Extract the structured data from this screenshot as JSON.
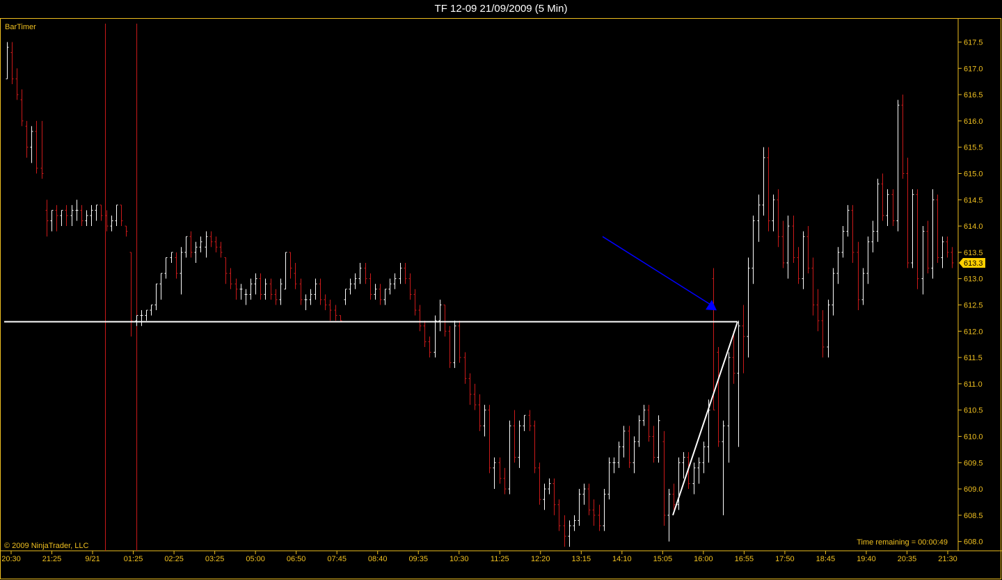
{
  "window": {
    "title": "TF 12-09  21/09/2009 (5 Min)"
  },
  "indicator_label": "BarTimer",
  "copyright": "© 2009 NinjaTrader, LLC",
  "time_remaining": "Time remaining = 00:00:49",
  "last_price_label": "613.3",
  "colors": {
    "background": "#000000",
    "border": "#f0c020",
    "text": "#f0c020",
    "up_bar": "#ffffff",
    "down_bar": "#cc1a1a",
    "session_line": "#cc1a1a",
    "hline": "#ffffff",
    "arrow": "#0000ff",
    "price_marker": "#ffd000"
  },
  "chart_data": {
    "type": "ohlc",
    "title": "TF 12-09  21/09/2009 (5 Min)",
    "ylim": [
      607.85,
      617.85
    ],
    "yticks": [
      "608.0",
      "608.5",
      "609.0",
      "609.5",
      "610.0",
      "610.5",
      "611.0",
      "611.5",
      "612.0",
      "612.5",
      "613.0",
      "613.5",
      "614.0",
      "614.5",
      "615.0",
      "615.5",
      "616.0",
      "616.5",
      "617.0",
      "617.5"
    ],
    "xticks": [
      "20:30",
      "21:25",
      "9/21",
      "01:25",
      "02:25",
      "03:25",
      "05:00",
      "06:50",
      "07:45",
      "08:40",
      "09:35",
      "10:30",
      "11:25",
      "12:20",
      "13:15",
      "14:10",
      "15:05",
      "16:00",
      "16:55",
      "17:50",
      "18:45",
      "19:40",
      "20:35",
      "21:30"
    ],
    "last_price": 613.3,
    "horizontal_line": 612.18,
    "session_breaks": [
      "21:25-9/21",
      "9/21"
    ],
    "bars": [
      [
        616.8,
        617.5,
        616.8,
        617.4
      ],
      [
        617.3,
        617.5,
        616.7,
        616.8
      ],
      [
        616.8,
        617.0,
        616.4,
        616.5
      ],
      [
        616.4,
        616.6,
        615.9,
        616.0
      ],
      [
        615.9,
        616.0,
        615.3,
        615.5
      ],
      [
        615.5,
        615.9,
        615.2,
        615.8
      ],
      [
        615.8,
        616.0,
        615.0,
        615.1
      ],
      [
        615.1,
        616.0,
        614.9,
        615.0
      ],
      [
        614.3,
        614.5,
        613.8,
        614.1
      ],
      [
        614.1,
        614.3,
        613.9,
        614.3
      ],
      [
        614.3,
        614.4,
        613.9,
        614.2
      ],
      [
        614.2,
        614.3,
        614.0,
        614.3
      ],
      [
        614.3,
        614.4,
        614.0,
        614.2
      ],
      [
        614.2,
        614.4,
        614.0,
        614.3
      ],
      [
        614.3,
        614.5,
        614.1,
        614.3
      ],
      [
        614.3,
        614.4,
        614.0,
        614.1
      ],
      [
        614.1,
        614.3,
        614.0,
        614.2
      ],
      [
        614.2,
        614.4,
        614.0,
        614.3
      ],
      [
        614.3,
        614.4,
        614.1,
        614.4
      ],
      [
        614.4,
        614.4,
        614.1,
        614.2
      ],
      [
        614.2,
        614.3,
        613.9,
        614.0
      ],
      [
        614.0,
        614.2,
        613.9,
        614.1
      ],
      [
        614.1,
        614.4,
        614.0,
        614.4
      ],
      [
        614.4,
        614.4,
        614.0,
        614.1
      ],
      [
        614.0,
        614.0,
        613.8,
        613.9
      ],
      [
        613.5,
        613.5,
        611.9,
        612.2
      ],
      [
        612.2,
        612.3,
        612.1,
        612.3
      ],
      [
        612.3,
        612.4,
        612.1,
        612.3
      ],
      [
        612.3,
        612.4,
        612.2,
        612.4
      ],
      [
        612.4,
        612.5,
        612.3,
        612.5
      ],
      [
        612.5,
        612.9,
        612.4,
        612.9
      ],
      [
        612.9,
        613.1,
        612.6,
        613.1
      ],
      [
        613.1,
        613.4,
        613.0,
        613.4
      ],
      [
        613.4,
        613.5,
        613.3,
        613.5
      ],
      [
        613.4,
        613.5,
        613.0,
        613.1
      ],
      [
        613.1,
        613.6,
        612.7,
        613.5
      ],
      [
        613.5,
        613.8,
        613.4,
        613.8
      ],
      [
        613.8,
        613.9,
        613.4,
        613.5
      ],
      [
        613.5,
        613.7,
        613.3,
        613.6
      ],
      [
        613.6,
        613.8,
        613.5,
        613.7
      ],
      [
        613.6,
        613.9,
        613.4,
        613.8
      ],
      [
        613.8,
        613.9,
        613.6,
        613.7
      ],
      [
        613.7,
        613.8,
        613.5,
        613.6
      ],
      [
        613.6,
        613.7,
        613.4,
        613.5
      ],
      [
        613.4,
        613.4,
        612.9,
        613.1
      ],
      [
        613.1,
        613.2,
        612.8,
        612.9
      ],
      [
        612.9,
        613.0,
        612.6,
        612.8
      ],
      [
        612.8,
        612.9,
        612.6,
        612.8
      ],
      [
        612.7,
        612.8,
        612.5,
        612.7
      ],
      [
        612.7,
        613.0,
        612.6,
        612.9
      ],
      [
        612.9,
        613.1,
        612.7,
        613.0
      ],
      [
        613.0,
        613.1,
        612.6,
        612.7
      ],
      [
        612.7,
        613.0,
        612.6,
        612.9
      ],
      [
        612.9,
        613.0,
        612.6,
        612.7
      ],
      [
        612.7,
        612.8,
        612.5,
        612.6
      ],
      [
        612.6,
        613.0,
        612.5,
        612.9
      ],
      [
        612.8,
        613.5,
        612.8,
        613.5
      ],
      [
        613.5,
        613.5,
        613.0,
        613.2
      ],
      [
        613.1,
        613.3,
        612.8,
        612.9
      ],
      [
        612.9,
        613.0,
        612.5,
        612.6
      ],
      [
        612.6,
        612.7,
        612.4,
        612.6
      ],
      [
        612.6,
        612.8,
        612.5,
        612.7
      ],
      [
        612.7,
        613.0,
        612.6,
        612.9
      ],
      [
        612.9,
        613.0,
        612.5,
        612.6
      ],
      [
        612.6,
        612.7,
        612.4,
        612.5
      ],
      [
        612.5,
        612.6,
        612.2,
        612.4
      ],
      [
        612.4,
        612.5,
        612.2,
        612.3
      ],
      [
        612.3,
        612.3,
        612.2,
        612.2
      ],
      [
        612.6,
        612.8,
        612.5,
        612.8
      ],
      [
        612.8,
        613.0,
        612.7,
        612.9
      ],
      [
        612.9,
        613.1,
        612.8,
        613.0
      ],
      [
        613.0,
        613.3,
        612.9,
        613.2
      ],
      [
        613.2,
        613.3,
        612.9,
        613.0
      ],
      [
        613.0,
        613.1,
        612.6,
        612.7
      ],
      [
        612.7,
        612.9,
        612.6,
        612.8
      ],
      [
        612.8,
        612.9,
        612.5,
        612.6
      ],
      [
        612.6,
        612.8,
        612.5,
        612.8
      ],
      [
        612.8,
        613.0,
        612.7,
        612.9
      ],
      [
        612.9,
        613.1,
        612.8,
        613.0
      ],
      [
        613.0,
        613.3,
        612.9,
        613.2
      ],
      [
        613.2,
        613.3,
        612.9,
        613.0
      ],
      [
        613.0,
        613.1,
        612.6,
        612.7
      ],
      [
        612.7,
        612.8,
        612.3,
        612.4
      ],
      [
        612.4,
        612.5,
        612.0,
        612.1
      ],
      [
        612.1,
        612.2,
        611.7,
        611.8
      ],
      [
        611.8,
        611.9,
        611.5,
        611.6
      ],
      [
        611.6,
        612.3,
        611.5,
        612.2
      ],
      [
        612.2,
        612.6,
        612.0,
        612.5
      ],
      [
        612.5,
        612.5,
        611.9,
        612.0
      ],
      [
        612.0,
        612.1,
        611.3,
        611.4
      ],
      [
        611.4,
        612.2,
        611.3,
        612.1
      ],
      [
        612.1,
        612.2,
        611.4,
        611.5
      ],
      [
        611.5,
        611.6,
        611.0,
        611.1
      ],
      [
        611.1,
        611.2,
        610.6,
        610.8
      ],
      [
        610.8,
        611.0,
        610.5,
        610.6
      ],
      [
        610.6,
        610.8,
        610.1,
        610.2
      ],
      [
        610.2,
        610.6,
        610.0,
        610.5
      ],
      [
        610.5,
        610.6,
        609.3,
        609.4
      ],
      [
        609.4,
        609.6,
        609.0,
        609.5
      ],
      [
        609.5,
        609.6,
        609.1,
        609.2
      ],
      [
        609.2,
        609.4,
        608.9,
        609.0
      ],
      [
        609.0,
        610.3,
        608.9,
        610.2
      ],
      [
        610.2,
        610.5,
        609.5,
        609.6
      ],
      [
        609.6,
        610.3,
        609.4,
        610.2
      ],
      [
        610.2,
        610.4,
        610.1,
        610.4
      ],
      [
        610.4,
        610.5,
        610.1,
        610.2
      ],
      [
        610.2,
        610.3,
        609.3,
        609.4
      ],
      [
        609.4,
        609.5,
        608.7,
        608.8
      ],
      [
        608.8,
        609.1,
        608.6,
        609.0
      ],
      [
        609.0,
        609.2,
        608.9,
        609.1
      ],
      [
        609.1,
        609.2,
        608.5,
        608.7
      ],
      [
        608.7,
        608.8,
        608.2,
        608.3
      ],
      [
        608.3,
        608.5,
        607.9,
        608.1
      ],
      [
        608.1,
        608.4,
        607.9,
        608.3
      ],
      [
        608.3,
        608.5,
        608.2,
        608.4
      ],
      [
        608.4,
        609.0,
        608.3,
        608.9
      ],
      [
        608.9,
        609.1,
        608.7,
        609.0
      ],
      [
        609.0,
        609.1,
        608.5,
        608.6
      ],
      [
        608.6,
        608.8,
        608.3,
        608.5
      ],
      [
        608.5,
        608.7,
        608.2,
        608.3
      ],
      [
        608.3,
        609.0,
        608.2,
        608.9
      ],
      [
        608.9,
        609.6,
        608.8,
        609.5
      ],
      [
        609.5,
        609.6,
        609.3,
        609.5
      ],
      [
        609.5,
        609.9,
        609.4,
        609.8
      ],
      [
        609.8,
        610.2,
        609.6,
        610.1
      ],
      [
        610.1,
        610.2,
        609.4,
        609.5
      ],
      [
        609.5,
        610.0,
        609.3,
        609.9
      ],
      [
        609.9,
        610.4,
        609.8,
        610.3
      ],
      [
        610.3,
        610.6,
        610.2,
        610.5
      ],
      [
        610.5,
        610.6,
        609.9,
        610.0
      ],
      [
        610.0,
        610.2,
        609.5,
        609.6
      ],
      [
        609.6,
        610.4,
        609.5,
        610.3
      ],
      [
        609.9,
        610.1,
        608.3,
        608.5
      ],
      [
        608.5,
        609.0,
        608.0,
        608.9
      ],
      [
        608.9,
        609.1,
        608.6,
        608.7
      ],
      [
        608.7,
        609.6,
        608.6,
        609.5
      ],
      [
        609.5,
        609.7,
        609.2,
        609.6
      ],
      [
        609.6,
        609.7,
        609.0,
        609.1
      ],
      [
        609.1,
        609.5,
        608.9,
        609.4
      ],
      [
        609.4,
        609.6,
        609.1,
        609.5
      ],
      [
        609.5,
        609.9,
        609.3,
        609.8
      ],
      [
        609.8,
        610.7,
        609.5,
        610.5
      ],
      [
        613.0,
        613.2,
        610.5,
        610.5
      ],
      [
        611.6,
        611.7,
        609.8,
        609.9
      ],
      [
        609.9,
        610.3,
        608.5,
        610.2
      ],
      [
        610.2,
        611.6,
        609.5,
        611.5
      ],
      [
        611.5,
        612.0,
        611.0,
        611.2
      ],
      [
        611.2,
        612.2,
        609.8,
        612.1
      ],
      [
        612.1,
        612.5,
        611.2,
        611.9
      ],
      [
        611.9,
        613.4,
        611.5,
        613.2
      ],
      [
        613.2,
        614.2,
        612.9,
        614.1
      ],
      [
        614.1,
        614.6,
        613.7,
        614.4
      ],
      [
        614.4,
        615.5,
        614.2,
        615.3
      ],
      [
        615.3,
        615.5,
        613.9,
        614.1
      ],
      [
        614.1,
        614.6,
        613.9,
        614.5
      ],
      [
        614.5,
        614.7,
        613.6,
        613.8
      ],
      [
        613.8,
        614.1,
        613.2,
        613.3
      ],
      [
        613.3,
        614.2,
        613.0,
        614.0
      ],
      [
        614.0,
        614.2,
        613.3,
        613.4
      ],
      [
        613.4,
        613.6,
        612.9,
        613.0
      ],
      [
        613.0,
        613.9,
        612.8,
        613.8
      ],
      [
        613.8,
        614.0,
        613.1,
        613.2
      ],
      [
        613.2,
        613.4,
        612.3,
        612.5
      ],
      [
        612.5,
        612.8,
        612.0,
        612.2
      ],
      [
        612.2,
        612.4,
        611.5,
        611.7
      ],
      [
        611.7,
        612.6,
        611.5,
        612.5
      ],
      [
        612.5,
        613.2,
        612.3,
        613.1
      ],
      [
        613.1,
        613.6,
        612.9,
        613.5
      ],
      [
        613.5,
        614.0,
        613.4,
        613.9
      ],
      [
        613.9,
        614.4,
        613.8,
        614.3
      ],
      [
        614.3,
        614.4,
        613.3,
        613.5
      ],
      [
        613.5,
        613.7,
        612.4,
        612.6
      ],
      [
        612.6,
        613.2,
        612.5,
        613.1
      ],
      [
        613.1,
        613.8,
        612.9,
        613.7
      ],
      [
        613.7,
        614.1,
        613.5,
        613.9
      ],
      [
        613.9,
        614.9,
        613.7,
        614.8
      ],
      [
        614.8,
        615.0,
        614.1,
        614.2
      ],
      [
        614.2,
        614.7,
        614.0,
        614.6
      ],
      [
        614.6,
        614.7,
        614.0,
        614.1
      ],
      [
        614.1,
        616.4,
        613.9,
        616.3
      ],
      [
        616.3,
        616.5,
        614.9,
        615.0
      ],
      [
        615.0,
        615.3,
        613.2,
        613.3
      ],
      [
        613.3,
        614.7,
        613.2,
        614.6
      ],
      [
        614.6,
        614.7,
        612.8,
        613.0
      ],
      [
        613.0,
        614.0,
        612.7,
        613.9
      ],
      [
        613.9,
        614.1,
        613.1,
        613.2
      ],
      [
        613.2,
        614.7,
        613.0,
        614.5
      ],
      [
        614.5,
        614.6,
        613.3,
        613.4
      ],
      [
        613.4,
        613.8,
        613.2,
        613.7
      ],
      [
        613.7,
        613.8,
        613.4,
        613.5
      ],
      [
        613.5,
        613.6,
        613.2,
        613.3
      ]
    ],
    "annotations": [
      {
        "type": "arrow",
        "color": "blue",
        "from": [
          "14:00",
          613.8
        ],
        "to": [
          "16:00",
          612.5
        ]
      },
      {
        "type": "line",
        "color": "white",
        "from": [
          "15:05",
          608.5
        ],
        "to": [
          "16:30",
          612.18
        ]
      }
    ]
  }
}
